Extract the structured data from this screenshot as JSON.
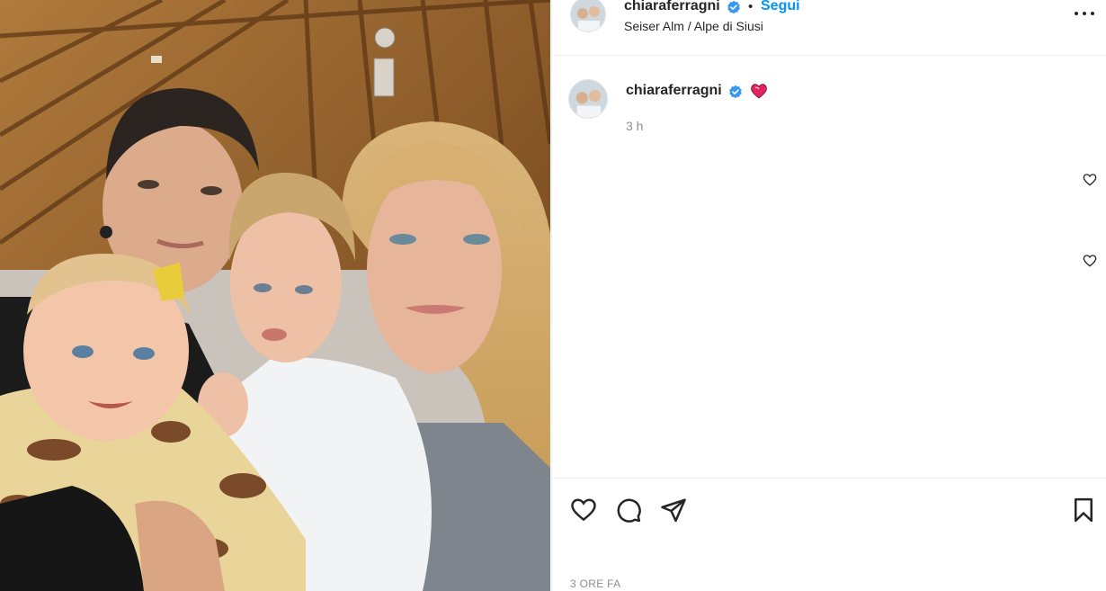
{
  "post": {
    "username": "chiaraferragni",
    "follow_label": "Segui",
    "separator": "•",
    "location": "Seiser Alm / Alpe di Siusi",
    "more_icon": "more-options-icon",
    "photo_alt": "family-selfie-photo"
  },
  "caption": {
    "username": "chiaraferragni",
    "emoji": "heart-emoji",
    "time": "3 h"
  },
  "actions": {
    "like_icon": "heart-icon",
    "comment_icon": "comment-icon",
    "share_icon": "share-icon",
    "save_icon": "bookmark-icon"
  },
  "footer": {
    "timestamp": "3 ORE FA"
  },
  "colors": {
    "link": "#0095f6",
    "text": "#262626",
    "muted": "#8e8e8e",
    "verified": "#3897f0",
    "border": "#efefef"
  }
}
